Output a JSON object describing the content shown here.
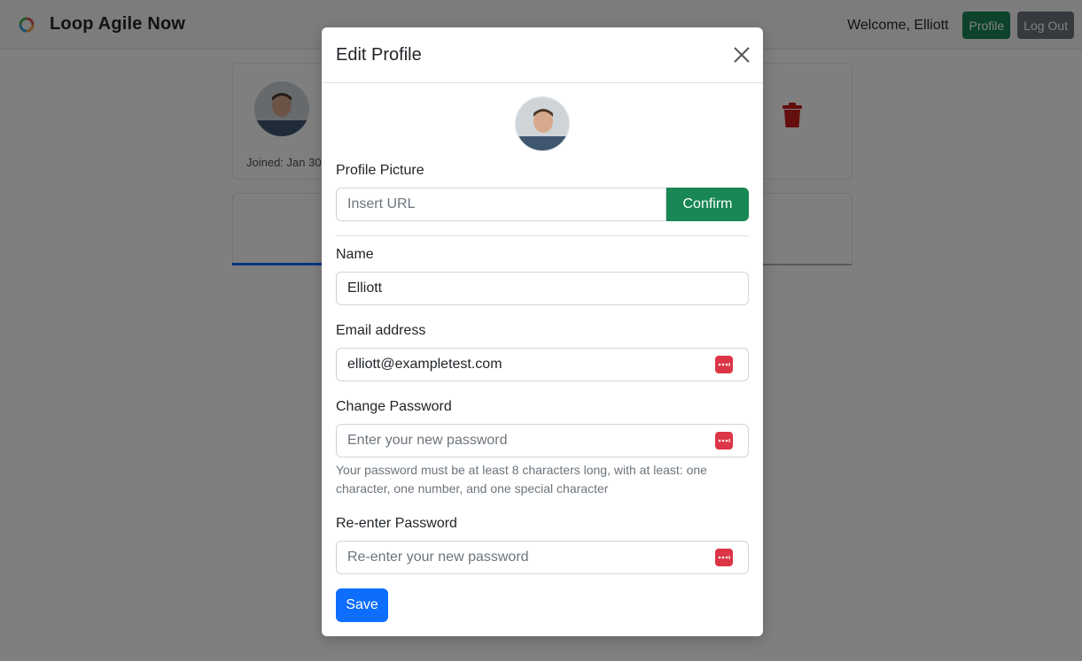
{
  "app": {
    "title": "Loop Agile Now"
  },
  "nav": {
    "welcome": "Welcome, Elliott",
    "profile_label": "Profile",
    "logout_label": "Log Out"
  },
  "background": {
    "joined_text": "Joined: Jan 30"
  },
  "modal": {
    "title": "Edit Profile",
    "profile_picture_label": "Profile Picture",
    "url_placeholder": "Insert URL",
    "confirm_label": "Confirm",
    "name_label": "Name",
    "name_value": "Elliott",
    "email_label": "Email address",
    "email_value": "elliott@exampletest.com",
    "password_label": "Change Password",
    "password_placeholder": "Enter your new password",
    "password_help": "Your password must be at least 8 characters long, with at least: one character, one number, and one special character",
    "reenter_label": "Re-enter Password",
    "reenter_placeholder": "Re-enter your new password",
    "save_label": "Save"
  },
  "colors": {
    "success": "#198754",
    "primary": "#0d6efd",
    "danger": "#dc3545",
    "secondary": "#6c757d"
  },
  "icons": [
    "app-logo-icon",
    "close-icon",
    "trash-icon",
    "password-manager-icon"
  ]
}
